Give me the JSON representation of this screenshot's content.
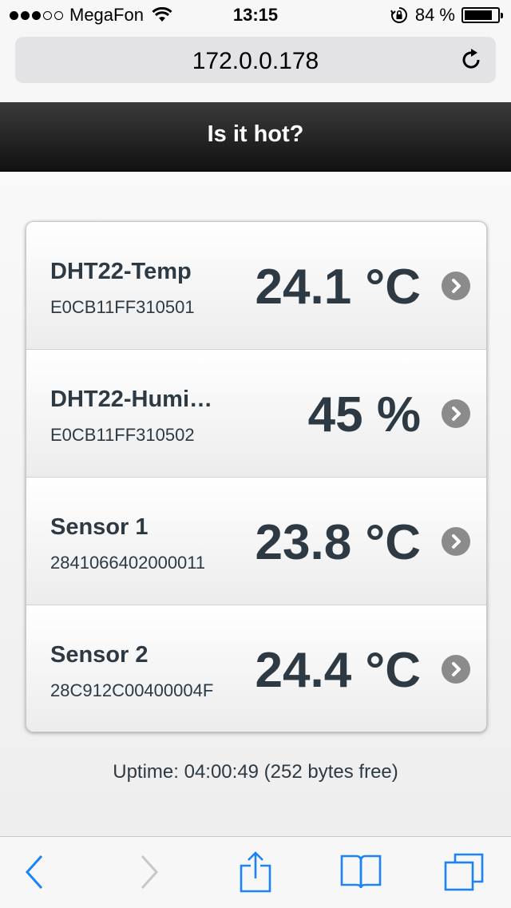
{
  "status_bar": {
    "carrier": "MegaFon",
    "signal_bars_filled": 3,
    "signal_bars_total": 5,
    "time": "13:15",
    "battery_text": "84 %",
    "battery_level": 0.84
  },
  "browser": {
    "url": "172.0.0.178"
  },
  "header": {
    "title": "Is it hot?"
  },
  "sensors": [
    {
      "name": "DHT22-Temp",
      "id": "E0CB11FF310501",
      "value": "24.1 °C"
    },
    {
      "name": "DHT22-Humi…",
      "id": "E0CB11FF310502",
      "value": "45 %"
    },
    {
      "name": "Sensor 1",
      "id": "2841066402000011",
      "value": "23.8 °C"
    },
    {
      "name": "Sensor 2",
      "id": "28C912C00400004F",
      "value": "24.4 °C"
    }
  ],
  "footer": {
    "uptime": "Uptime: 04:00:49 (252 bytes free)"
  },
  "toolbar": {
    "icons": [
      "back-icon",
      "forward-icon",
      "share-icon",
      "bookmarks-icon",
      "tabs-icon"
    ]
  },
  "colors": {
    "accent": "#1a82fb",
    "disabled": "#c7c7cc",
    "text": "#2d3a44"
  }
}
